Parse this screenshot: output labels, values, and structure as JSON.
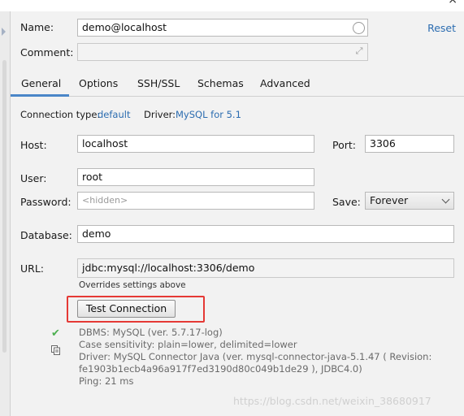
{
  "form": {
    "name_label": "Name:",
    "name_value": "demo@localhost",
    "reset": "Reset",
    "comment_label": "Comment:",
    "comment_value": ""
  },
  "tabs": [
    "General",
    "Options",
    "SSH/SSL",
    "Schemas",
    "Advanced"
  ],
  "active_tab": "General",
  "connection": {
    "type_label": "Connection type:",
    "type_value": "default",
    "driver_label": "Driver:",
    "driver_value": "MySQL for 5.1"
  },
  "fields": {
    "host_label": "Host:",
    "host_value": "localhost",
    "port_label": "Port:",
    "port_value": "3306",
    "user_label": "User:",
    "user_value": "root",
    "password_label": "Password:",
    "password_value": "<hidden>",
    "save_label": "Save:",
    "save_value": "Forever",
    "database_label": "Database:",
    "database_value": "demo",
    "url_label": "URL:",
    "url_value": "jdbc:mysql://localhost:3306/demo",
    "url_note": "Overrides settings above"
  },
  "test": {
    "button_label": "Test Connection"
  },
  "status_lines": [
    "DBMS: MySQL (ver. 5.7.17-log)",
    "Case sensitivity: plain=lower, delimited=lower",
    "Driver: MySQL Connector Java (ver. mysql-connector-java-5.1.47 ( Revision:",
    "fe1903b1ecb4a96a917f7ed3190d80c049b1de29 ), JDBC4.0)",
    "Ping: 21 ms"
  ],
  "watermark": "https://blog.csdn.net/weixin_38680917",
  "colors": {
    "link": "#2b6cb0",
    "highlight": "#e53935",
    "success": "#4caf50"
  },
  "icons": [
    "close-icon",
    "clear-icon",
    "expand-icon",
    "chevron-down-icon",
    "check-icon",
    "copy-icon"
  ]
}
